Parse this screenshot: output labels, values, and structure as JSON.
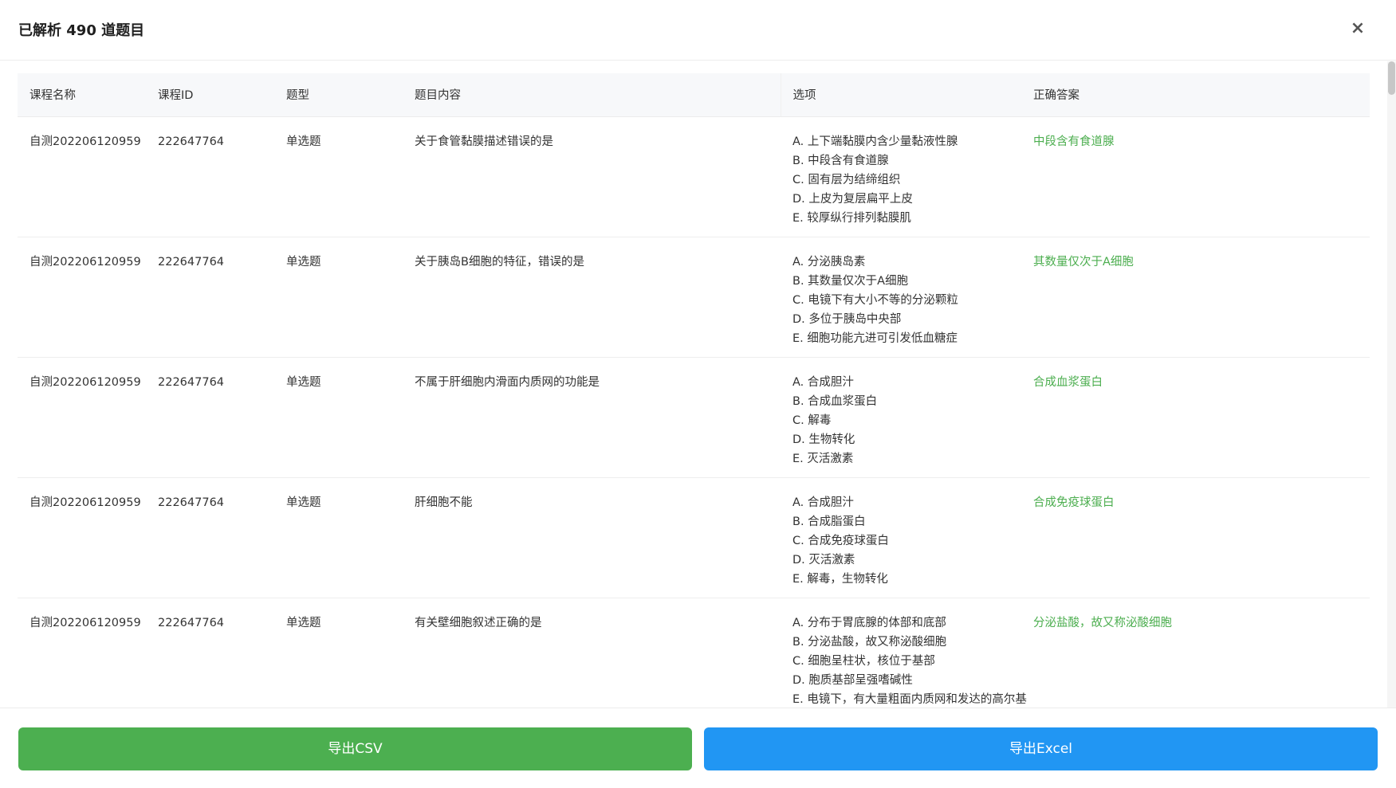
{
  "header": {
    "title": "已解析 490 道题目",
    "close": "×"
  },
  "table": {
    "columns": [
      "课程名称",
      "课程ID",
      "题型",
      "题目内容",
      "选项",
      "正确答案"
    ],
    "rows": [
      {
        "course": "自测202206120959",
        "course_id": "222647764",
        "type": "单选题",
        "question": "关于食管黏膜描述错误的是",
        "options": [
          "A. 上下端黏膜内含少量黏液性腺",
          "B. 中段含有食道腺",
          "C. 固有层为结缔组织",
          "D. 上皮为复层扁平上皮",
          "E. 较厚纵行排列黏膜肌"
        ],
        "answer": "中段含有食道腺"
      },
      {
        "course": "自测202206120959",
        "course_id": "222647764",
        "type": "单选题",
        "question": "关于胰岛B细胞的特征，错误的是",
        "options": [
          "A. 分泌胰岛素",
          "B. 其数量仅次于A细胞",
          "C. 电镜下有大小不等的分泌颗粒",
          "D. 多位于胰岛中央部",
          "E. 细胞功能亢进可引发低血糖症"
        ],
        "answer": "其数量仅次于A细胞"
      },
      {
        "course": "自测202206120959",
        "course_id": "222647764",
        "type": "单选题",
        "question": "不属于肝细胞内滑面内质网的功能是",
        "options": [
          "A. 合成胆汁",
          "B. 合成血浆蛋白",
          "C. 解毒",
          "D. 生物转化",
          "E. 灭活激素"
        ],
        "answer": "合成血浆蛋白"
      },
      {
        "course": "自测202206120959",
        "course_id": "222647764",
        "type": "单选题",
        "question": "肝细胞不能",
        "options": [
          "A. 合成胆汁",
          "B. 合成脂蛋白",
          "C. 合成免疫球蛋白",
          "D. 灭活激素",
          "E. 解毒，生物转化"
        ],
        "answer": "合成免疫球蛋白"
      },
      {
        "course": "自测202206120959",
        "course_id": "222647764",
        "type": "单选题",
        "question": "有关壁细胞叙述正确的是",
        "options": [
          "A. 分布于胃底腺的体部和底部",
          "B. 分泌盐酸，故又称泌酸细胞",
          "C. 细胞呈柱状，核位于基部",
          "D. 胞质基部呈强嗜碱性",
          "E. 电镜下，有大量粗面内质网和发达的高尔基"
        ],
        "answer": "分泌盐酸，故又称泌酸细胞"
      }
    ]
  },
  "footer": {
    "export_csv": "导出CSV",
    "export_excel": "导出Excel"
  },
  "colors": {
    "answer": "#4cae4f",
    "csv_button": "#4caf50",
    "excel_button": "#2196f3"
  }
}
